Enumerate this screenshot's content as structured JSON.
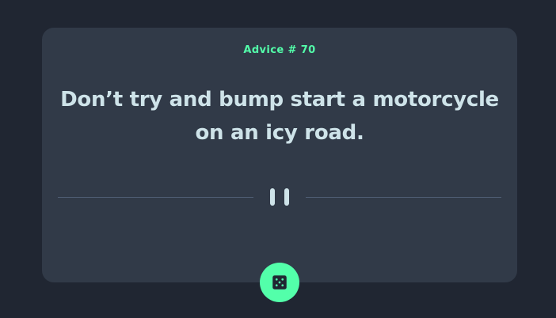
{
  "advice": {
    "label": "Advice # 70",
    "text": "Don’t try and bump start a motorcycle on an icy road."
  },
  "divider": {
    "icon": "pause-icon"
  },
  "dice_button": {
    "icon": "dice-icon"
  },
  "colors": {
    "background": "#202632",
    "card": "#313A48",
    "accent": "#53FFAA",
    "text": "#CEE3E9",
    "divider": "#4F5D74"
  }
}
